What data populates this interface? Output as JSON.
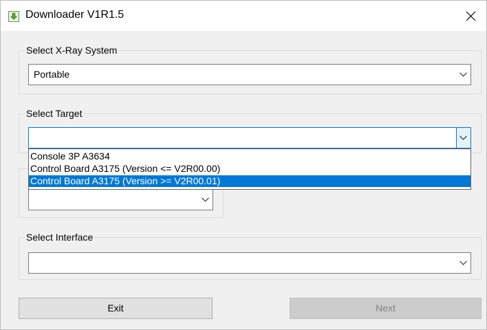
{
  "window": {
    "title": "Downloader V1R1.5",
    "icon": "download-icon",
    "close_icon": "close-icon"
  },
  "xray_group": {
    "label": "Select X-Ray System",
    "selected_value": "Portable"
  },
  "target_group": {
    "label": "Select Target",
    "selected_value": "",
    "options": [
      {
        "label": "Console 3P A3634",
        "highlighted": false
      },
      {
        "label": "Control Board A3175 (Version <= V2R00.00)",
        "highlighted": false
      },
      {
        "label": "Control Board A3175 (Version >= V2R00.01)",
        "highlighted": true
      }
    ]
  },
  "hidden_group": {
    "selected_value": ""
  },
  "interface_group": {
    "label": "Select Interface",
    "selected_value": ""
  },
  "buttons": {
    "exit_label": "Exit",
    "next_label": "Next",
    "next_enabled": false
  },
  "colors": {
    "selection": "#0078d7",
    "window_bg": "#f0f0f0"
  }
}
